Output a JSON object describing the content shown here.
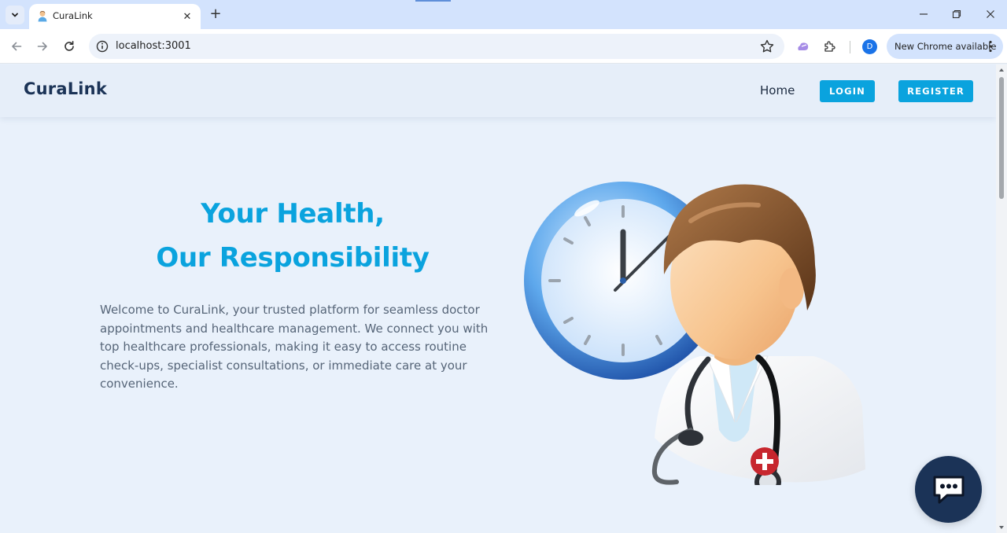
{
  "browser": {
    "tab_title": "CuraLink",
    "url": "localhost:3001",
    "update_label": "New Chrome available",
    "profile_initial": "D"
  },
  "header": {
    "logo": "CuraLink",
    "nav_home": "Home",
    "login_label": "LOGIN",
    "register_label": "REGISTER"
  },
  "hero": {
    "title_line1": "Your Health,",
    "title_line2": "Our Responsibility",
    "description": "Welcome to CuraLink, your trusted platform for seamless doctor appointments and healthcare management. We connect you with top healthcare professionals, making it easy to access routine check-ups, specialist consultations, or immediate care at your convenience."
  },
  "colors": {
    "accent": "#0aa3de",
    "navy": "#1b3357",
    "page_background": "#e9f1fb"
  },
  "icons": {
    "chat": "chat-bubble-icon",
    "illustration": "doctor-clock-illustration"
  }
}
